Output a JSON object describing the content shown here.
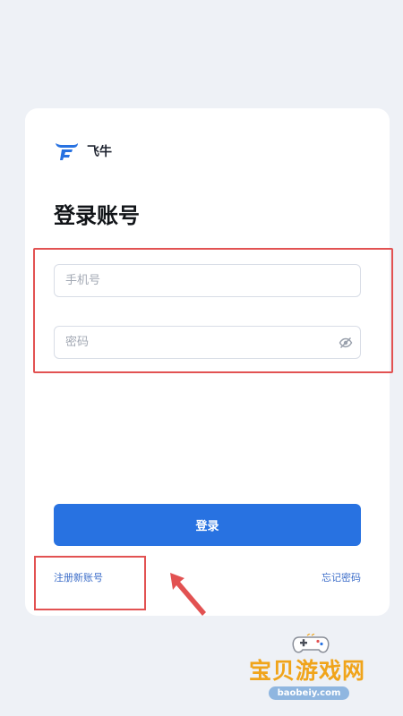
{
  "app": {
    "brand_name": "飞牛"
  },
  "login": {
    "title": "登录账号",
    "phone_placeholder": "手机号",
    "password_placeholder": "密码",
    "submit_label": "登录",
    "register_link": "注册新账号",
    "forgot_link": "忘记密码"
  },
  "watermark": {
    "title": "宝贝游戏网",
    "url": "baobeiy.com"
  },
  "colors": {
    "primary": "#2872e1",
    "highlight": "#e25252",
    "link": "#3d6ec9",
    "background": "#eef1f6"
  },
  "icons": {
    "brand": "bull-logo-icon",
    "password_toggle": "eye-off-icon",
    "annotation": "arrow-icon",
    "watermark": "gamepad-icon"
  }
}
